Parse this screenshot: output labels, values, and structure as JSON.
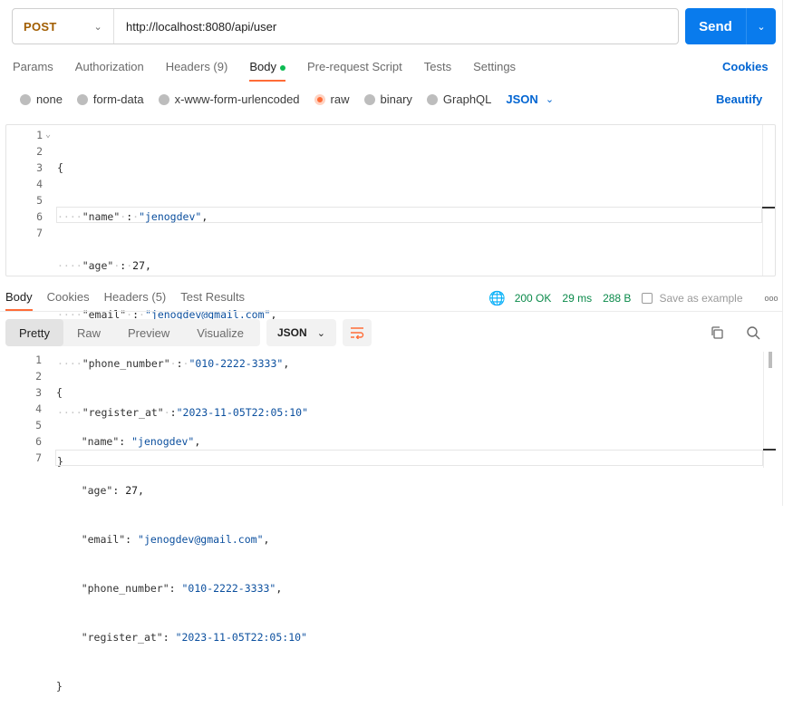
{
  "request": {
    "method": "POST",
    "url": "http://localhost:8080/api/user",
    "send_label": "Send"
  },
  "request_tabs": {
    "items": [
      "Params",
      "Authorization",
      "Headers (9)",
      "Body",
      "Pre-request Script",
      "Tests",
      "Settings"
    ],
    "active": "Body",
    "cookies_label": "Cookies"
  },
  "body_types": {
    "options": [
      "none",
      "form-data",
      "x-www-form-urlencoded",
      "raw",
      "binary",
      "GraphQL"
    ],
    "selected": "raw",
    "format": "JSON",
    "beautify_label": "Beautify"
  },
  "request_body": {
    "line_numbers": [
      "1",
      "2",
      "3",
      "4",
      "5",
      "6",
      "7"
    ],
    "open_brace": "{",
    "close_brace": "}",
    "fields": [
      {
        "key": "\"name\"",
        "value": "\"jenogdev\"",
        "comma": ","
      },
      {
        "key": "\"age\"",
        "value": "27",
        "comma": ","
      },
      {
        "key": "\"email\"",
        "value": "\"jenogdev@gmail.com\"",
        "comma": ","
      },
      {
        "key": "\"phone_number\"",
        "value": "\"010-2222-3333\"",
        "comma": ","
      },
      {
        "key": "\"register_at\"",
        "value": "\"2023-11-05T22:05:10\"",
        "comma": ""
      }
    ]
  },
  "response_tabs": {
    "items": [
      "Body",
      "Cookies",
      "Headers (5)",
      "Test Results"
    ],
    "active": "Body"
  },
  "response_meta": {
    "status": "200 OK",
    "time": "29 ms",
    "size": "288 B",
    "save_label": "Save as example",
    "more": "ooo"
  },
  "response_view": {
    "modes": [
      "Pretty",
      "Raw",
      "Preview",
      "Visualize"
    ],
    "active": "Pretty",
    "format": "JSON"
  },
  "response_body": {
    "line_numbers": [
      "1",
      "2",
      "3",
      "4",
      "5",
      "6",
      "7"
    ],
    "open_brace": "{",
    "close_brace": "}",
    "fields": [
      {
        "key": "\"name\"",
        "value": "\"jenogdev\"",
        "comma": ","
      },
      {
        "key": "\"age\"",
        "value": "27",
        "comma": ","
      },
      {
        "key": "\"email\"",
        "value": "\"jenogdev@gmail.com\"",
        "comma": ","
      },
      {
        "key": "\"phone_number\"",
        "value": "\"010-2222-3333\"",
        "comma": ","
      },
      {
        "key": "\"register_at\"",
        "value": "\"2023-11-05T22:05:10\"",
        "comma": ""
      }
    ]
  },
  "colors": {
    "accent": "#ff6c37",
    "send": "#097bed",
    "method": "#a15d00",
    "status_ok": "#0a8a4a",
    "link": "#0265d2"
  }
}
